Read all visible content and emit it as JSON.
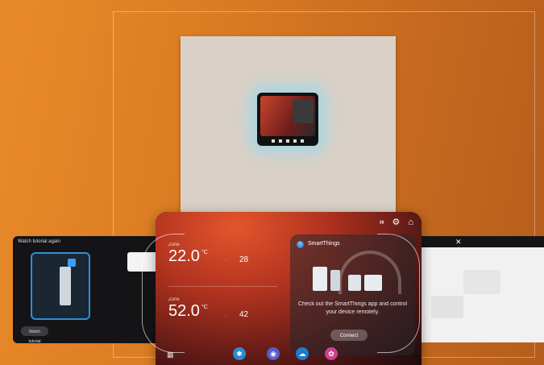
{
  "left_panel": {
    "title": "Watch tutorial again",
    "button": "Watch tutorial"
  },
  "device": {
    "status_icons": [
      "settings-icon",
      "home-icon"
    ],
    "zone1": {
      "label": "Zone",
      "temp": "22.0",
      "unit": "°C",
      "setpoint": "28"
    },
    "zone2": {
      "label": "Zone",
      "temp": "52.0",
      "unit": "°C",
      "setpoint": "42"
    },
    "card": {
      "title": "SmartThings",
      "message": "Check out the SmartThings app and control your device remotely.",
      "button": "Connect"
    },
    "dock_icons": [
      "grid-icon",
      "fan-icon",
      "globe-icon",
      "cloud-icon",
      "gear-icon"
    ]
  },
  "right_panel": {
    "close": "✕"
  }
}
